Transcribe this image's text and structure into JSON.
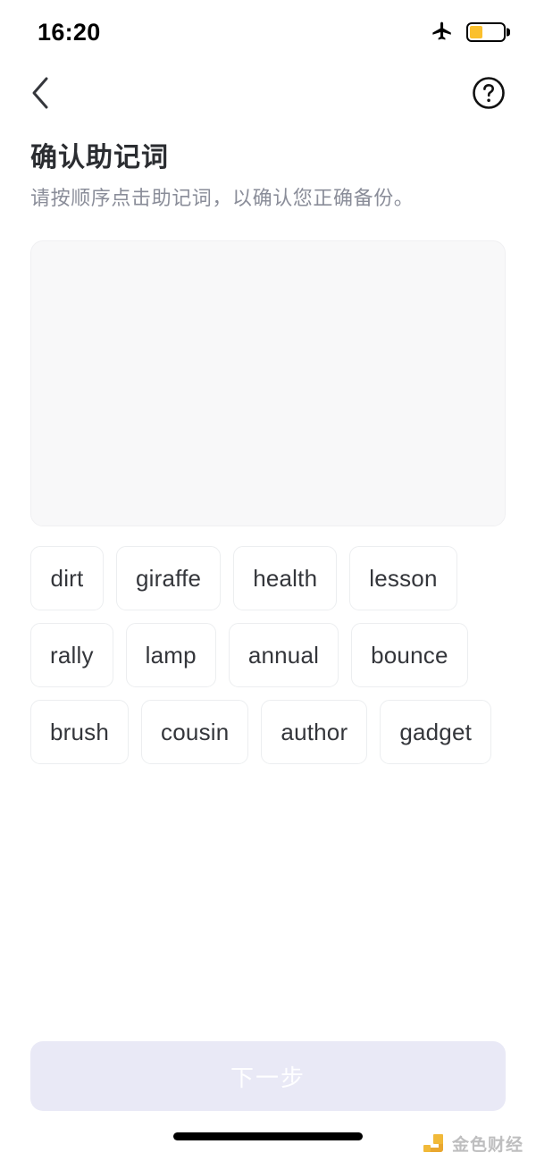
{
  "status_bar": {
    "time": "16:20",
    "airplane_icon": "airplane-icon",
    "battery_icon": "battery-icon",
    "battery_level_percent": 40,
    "battery_color": "#fbc02d"
  },
  "nav_bar": {
    "back_icon": "chevron-left-icon",
    "help_icon": "help-circle-icon"
  },
  "header": {
    "title": "确认助记词",
    "subtitle": "请按顺序点击助记词，以确认您正确备份。"
  },
  "answer_area": {
    "selected_words": [],
    "background_color": "#f8f8f9"
  },
  "word_bank": {
    "words": [
      "dirt",
      "giraffe",
      "health",
      "lesson",
      "rally",
      "lamp",
      "annual",
      "bounce",
      "brush",
      "cousin",
      "author",
      "gadget"
    ]
  },
  "footer": {
    "next_button_label": "下一步",
    "next_button_enabled": false,
    "next_button_color": "#e9e9f6"
  },
  "watermark": {
    "text": "金色财经",
    "logo_icon": "jinse-logo-icon",
    "logo_color": "#f0b429"
  }
}
